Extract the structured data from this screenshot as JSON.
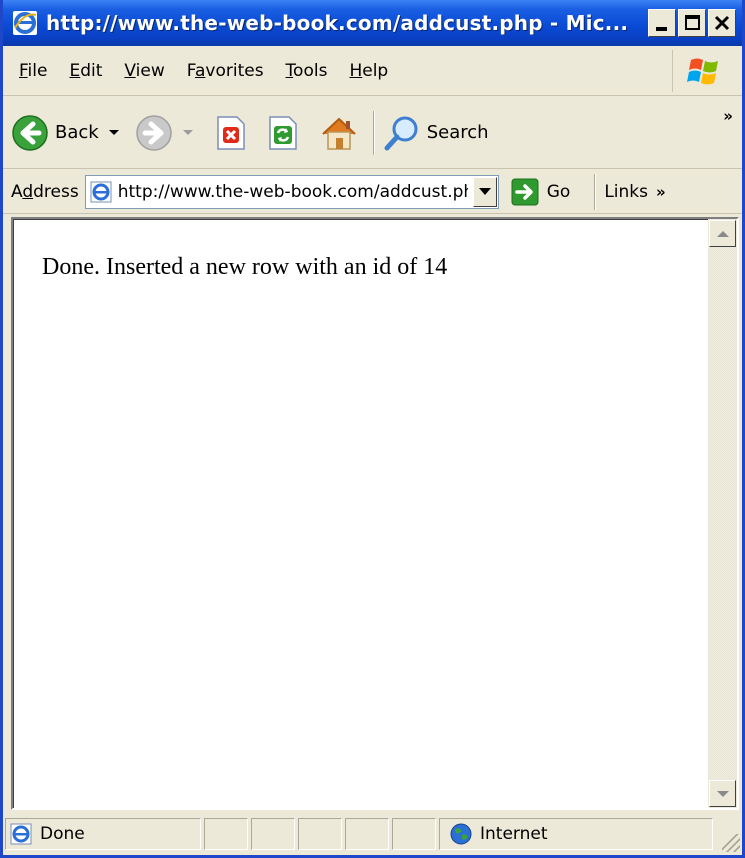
{
  "window": {
    "title": "http://www.the-web-book.com/addcust.php - Mic...",
    "controls": [
      "minimize",
      "maximize",
      "close"
    ]
  },
  "menubar": {
    "items": [
      {
        "label": "File",
        "accel": "F"
      },
      {
        "label": "Edit",
        "accel": "E"
      },
      {
        "label": "View",
        "accel": "V"
      },
      {
        "label": "Favorites",
        "accel": "a"
      },
      {
        "label": "Tools",
        "accel": "T"
      },
      {
        "label": "Help",
        "accel": "H"
      }
    ]
  },
  "toolbar": {
    "back_label": "Back",
    "search_label": "Search",
    "overflow": "»"
  },
  "addressbar": {
    "label": "Address",
    "url": "http://www.the-web-book.com/addcust.php",
    "go_label": "Go",
    "links_label": "Links",
    "links_overflow": "»"
  },
  "page": {
    "message": "Done. Inserted a new row with an id of 14"
  },
  "statusbar": {
    "status": "Done",
    "zone": "Internet"
  },
  "colors": {
    "titlebar": "#0a4bd6",
    "chrome": "#ece9d8",
    "content_bg": "#ffffff"
  }
}
